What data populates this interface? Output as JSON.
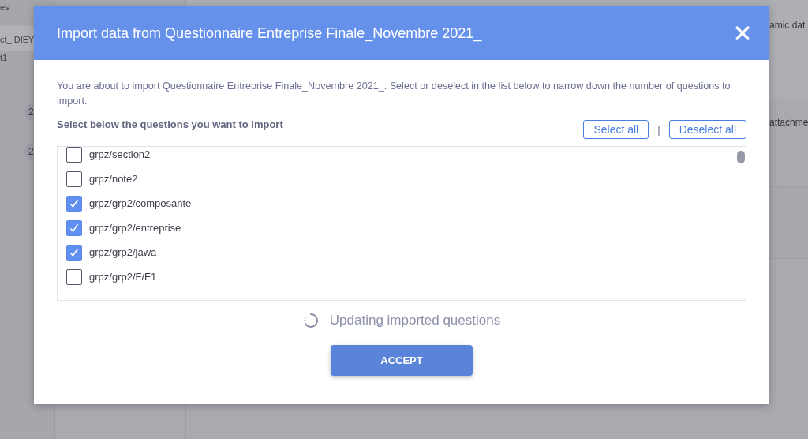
{
  "background": {
    "sidebar_texts": [
      "es",
      "ct_ DIEY",
      "t1"
    ],
    "badges": [
      "2",
      "2"
    ],
    "right_texts": [
      "amic dat",
      "attachme"
    ]
  },
  "dialog": {
    "title": "Import data from Questionnaire Entreprise Finale_Novembre 2021_",
    "description": "You are about to import Questionnaire Entreprise Finale_Novembre 2021_. Select or deselect in the list below to narrow down the number of questions to import.",
    "subheading": "Select below the questions you want to import",
    "select_all": "Select all",
    "separator": "|",
    "deselect_all": "Deselect all",
    "questions": [
      {
        "label": "grpz/section2",
        "checked": false
      },
      {
        "label": "grpz/note2",
        "checked": false
      },
      {
        "label": "grpz/grp2/composante",
        "checked": true
      },
      {
        "label": "grpz/grp2/entreprise",
        "checked": true
      },
      {
        "label": "grpz/grp2/jawa",
        "checked": true
      },
      {
        "label": "grpz/grp2/F/F1",
        "checked": false
      }
    ],
    "status": "Updating imported questions",
    "accept": "ACCEPT"
  }
}
